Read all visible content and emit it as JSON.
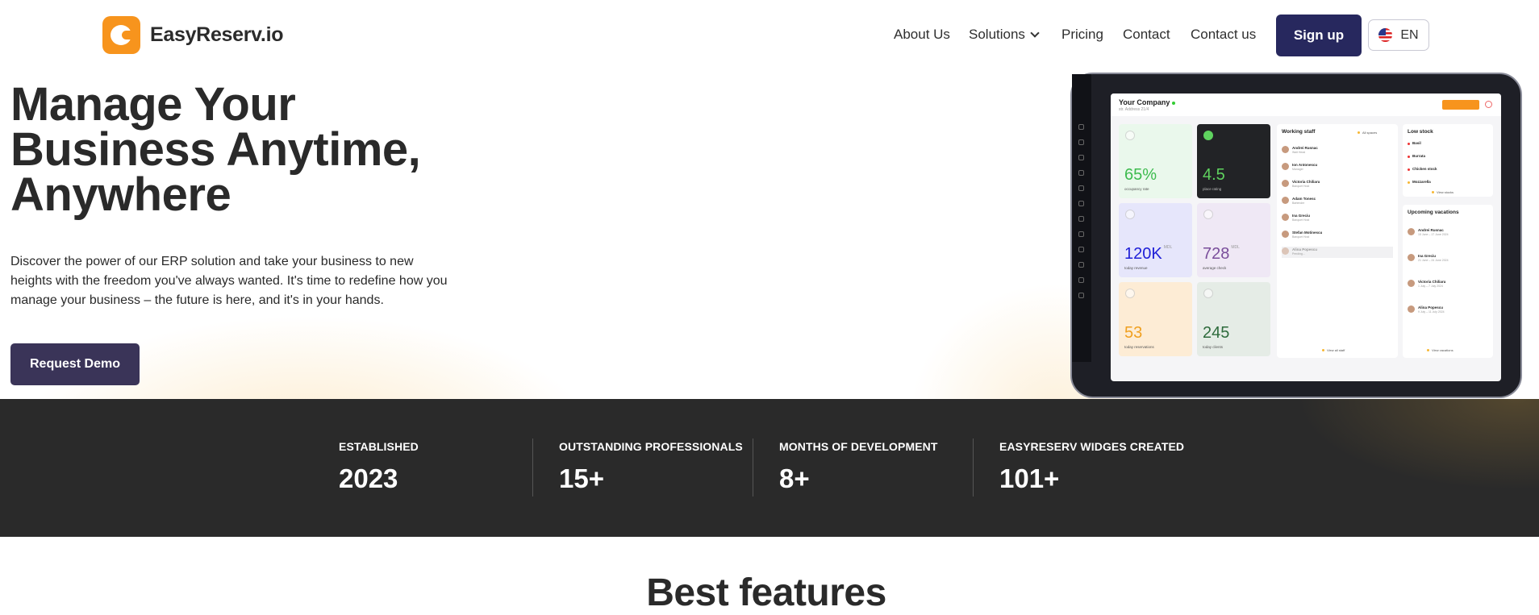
{
  "brand": {
    "name": "EasyReserv.io",
    "accent": "#f7941d"
  },
  "nav": {
    "about": "About Us",
    "solutions": "Solutions",
    "pricing": "Pricing",
    "contact": "Contact",
    "contact_us": "Contact us",
    "signup": "Sign up",
    "language": "EN"
  },
  "hero": {
    "title_lines": [
      "Manage Your",
      "Business Anytime,",
      "Anywhere"
    ],
    "description": "Discover the power of our ERP solution and take your business to new heights with the freedom you've always wanted. It's time to redefine how you manage your business – the future is here, and it's in your hands.",
    "cta": "Request Demo"
  },
  "dashboard": {
    "company": "Your Company",
    "address": "str. Address 21/4",
    "cards": [
      {
        "value": "65%",
        "label": "occupancy rate",
        "color": "#3dbb4e",
        "bg": "#eaf8ec"
      },
      {
        "value": "4.5",
        "label": "place rating",
        "color": "#5fd35f",
        "bg": "#222326"
      },
      {
        "value": "120K",
        "unit": "MDL",
        "label": "today revenue",
        "color": "#2020d8",
        "bg": "#e6e6fb"
      },
      {
        "value": "728",
        "unit": "MDL",
        "label": "average check",
        "color": "#7a4e9b",
        "bg": "#efe8f5"
      },
      {
        "value": "53",
        "label": "today reservations",
        "color": "#f0a020",
        "bg": "#fdecd5"
      },
      {
        "value": "245",
        "label": "today clients",
        "color": "#2e6b3c",
        "bg": "#e5ece6"
      }
    ],
    "working_staff": {
      "title": "Working staff",
      "filter": "All spaces",
      "people": [
        {
          "name": "Andrei Rusnac",
          "role": "Wait Head"
        },
        {
          "name": "Ion Antonescu",
          "role": "Manager"
        },
        {
          "name": "Victoria Chiliaru",
          "role": "Banquet Host"
        },
        {
          "name": "Adam Tonesc",
          "role": "Bartender"
        },
        {
          "name": "Ina Greciu",
          "role": "Banquet Host"
        },
        {
          "name": "Stefan Motinescu",
          "role": "Banquet Host"
        },
        {
          "name": "Alina Popescu",
          "role": "Pending..."
        }
      ],
      "link": "View all staff"
    },
    "low_stock": {
      "title": "Low stock",
      "items": [
        "Basil",
        "Burrata",
        "Chicken stock",
        "Mozzarella"
      ],
      "link": "View stocks"
    },
    "vacations": {
      "title": "Upcoming vacations",
      "people": [
        {
          "name": "Andrei Rusnac",
          "dates": "15 June – 17 June 2024"
        },
        {
          "name": "Ina Greciu",
          "dates": "21 June – 24 June 2024"
        },
        {
          "name": "Victoria Chiliaru",
          "dates": "1 July – 7 July 2024"
        },
        {
          "name": "Alina Popescu",
          "dates": "9 July – 11 July 2024"
        }
      ],
      "link": "View vacations"
    }
  },
  "stats": [
    {
      "label": "ESTABLISHED",
      "value": "2023"
    },
    {
      "label": "OUTSTANDING PROFESSIONALS",
      "value": "15+"
    },
    {
      "label": "MONTHS OF DEVELOPMENT",
      "value": "8+"
    },
    {
      "label": "EASYRESERV WIDGES CREATED",
      "value": "101+"
    }
  ],
  "features": {
    "title": "Best features"
  }
}
